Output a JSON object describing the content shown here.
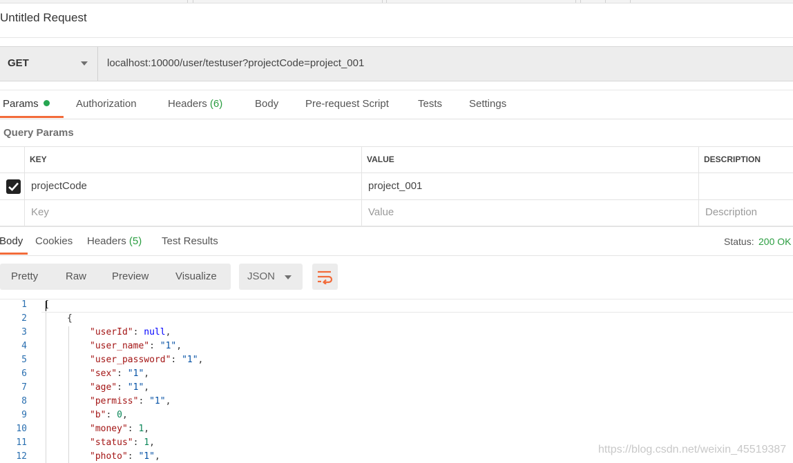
{
  "request": {
    "title": "Untitled Request",
    "method": "GET",
    "url": "localhost:10000/user/testuser?projectCode=project_001"
  },
  "request_tabs": [
    {
      "label": "Params",
      "active": true,
      "has_dot": true
    },
    {
      "label": "Authorization"
    },
    {
      "label": "Headers",
      "count": "(6)"
    },
    {
      "label": "Body"
    },
    {
      "label": "Pre-request Script"
    },
    {
      "label": "Tests"
    },
    {
      "label": "Settings"
    }
  ],
  "query_params": {
    "label": "Query Params",
    "columns": [
      "KEY",
      "VALUE",
      "DESCRIPTION"
    ],
    "rows": [
      {
        "checked": true,
        "key": "projectCode",
        "value": "project_001",
        "description": ""
      }
    ],
    "placeholder": {
      "key": "Key",
      "value": "Value",
      "description": "Description"
    }
  },
  "response_tabs": [
    {
      "label": "Body",
      "active": true
    },
    {
      "label": "Cookies"
    },
    {
      "label": "Headers",
      "count": "(5)"
    },
    {
      "label": "Test Results"
    }
  ],
  "status": {
    "label": "Status:",
    "value": "200 OK"
  },
  "view_modes": [
    "Pretty",
    "Raw",
    "Preview",
    "Visualize"
  ],
  "format": "JSON",
  "icons": {
    "wrap": "wrap-lines-icon",
    "caret": "chevron-down-icon",
    "check": "check-icon"
  },
  "colors": {
    "accent": "#f26b3a",
    "success": "#2a9d40",
    "dot": "#26a651"
  },
  "editor": {
    "line_numbers": [
      "1",
      "2",
      "3",
      "4",
      "5",
      "6",
      "7",
      "8",
      "9",
      "10",
      "11",
      "12"
    ],
    "lines": [
      {
        "open": "["
      },
      {
        "open": "{"
      },
      {
        "key": "\"userId\"",
        "val": "null",
        "kind": "kw"
      },
      {
        "key": "\"user_name\"",
        "val": "\"1\"",
        "kind": "s"
      },
      {
        "key": "\"user_password\"",
        "val": "\"1\"",
        "kind": "s"
      },
      {
        "key": "\"sex\"",
        "val": "\"1\"",
        "kind": "s"
      },
      {
        "key": "\"age\"",
        "val": "\"1\"",
        "kind": "s"
      },
      {
        "key": "\"permiss\"",
        "val": "\"1\"",
        "kind": "s"
      },
      {
        "key": "\"b\"",
        "val": "0",
        "kind": "n"
      },
      {
        "key": "\"money\"",
        "val": "1",
        "kind": "n"
      },
      {
        "key": "\"status\"",
        "val": "1",
        "kind": "n"
      },
      {
        "key": "\"photo\"",
        "val": "\"1\"",
        "kind": "s"
      }
    ]
  },
  "watermark": "https://blog.csdn.net/weixin_45519387"
}
